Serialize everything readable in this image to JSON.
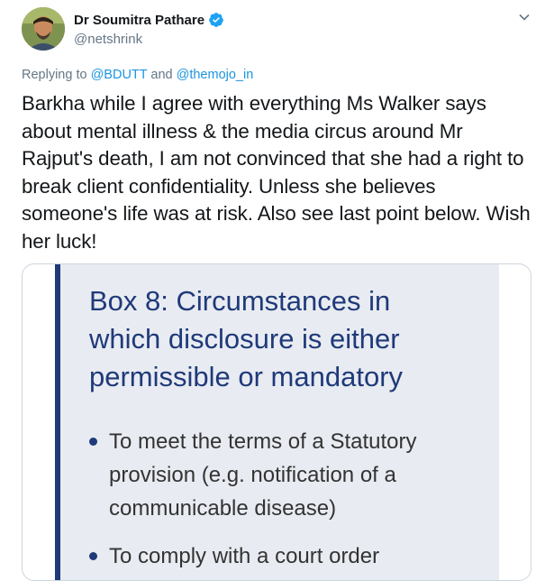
{
  "author": {
    "display_name": "Dr Soumitra Pathare",
    "handle": "@netshrink"
  },
  "reply": {
    "prefix": "Replying to ",
    "user1": "@BDUTT",
    "joiner": " and ",
    "user2": "@themojo_in"
  },
  "tweet_text": "Barkha while I agree with everything Ms Walker says about mental illness & the media circus around Mr Rajput's death, I am not convinced that she had a right to break client confidentiality. Unless she believes someone's life was at risk. Also see last point below. Wish her luck!",
  "image_card": {
    "title": "Box 8: Circumstances in which disclosure is either permissible or mandatory",
    "bullets": [
      "To meet the terms of a Statutory provision (e.g. notification of a communicable disease)",
      "To comply with a court order"
    ]
  },
  "colors": {
    "link": "#1b95e0",
    "verified": "#1da1f2",
    "box_accent": "#1f3a7a",
    "box_bg": "#e8ebf1"
  },
  "icons": [
    "verified-icon",
    "chevron-down-icon"
  ]
}
